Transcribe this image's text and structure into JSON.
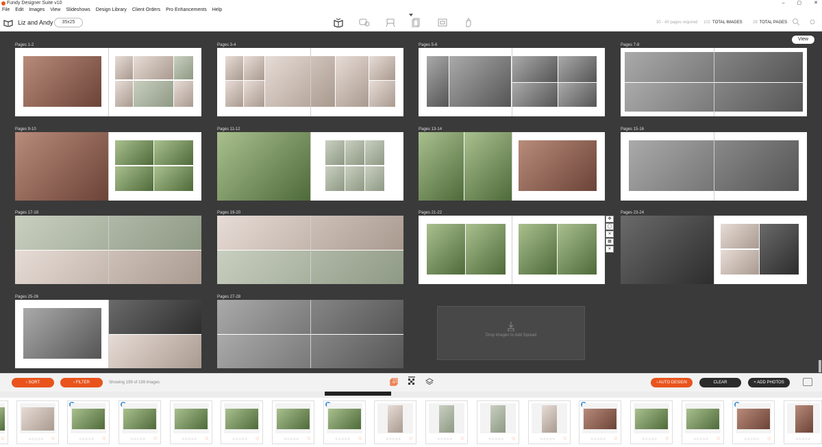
{
  "app": {
    "title": "Fundy Designer Suite v10",
    "window_controls": [
      "–",
      "▢",
      "✕"
    ]
  },
  "menu": [
    "File",
    "Edit",
    "Images",
    "View",
    "Slideshows",
    "Design Library",
    "Client Orders",
    "Pro Enhancements",
    "Help"
  ],
  "toolbar": {
    "project_name": "Liz and Andy",
    "album_size": "35x25",
    "pages_required": "30 - 40 pages required",
    "total_images_count": "102",
    "total_images_label": "TOTAL IMAGES",
    "total_pages_count": "28",
    "total_pages_label": "TOTAL PAGES",
    "view_icons": [
      "album-icon",
      "proof-icon",
      "wall-art-icon",
      "cards-icon",
      "slideshow-icon",
      "hand-icon"
    ]
  },
  "workspace": {
    "view_label": "View",
    "spreads": [
      "Pages 1-2",
      "Pages 3-4",
      "Pages 5-6",
      "Pages 7-8",
      "Pages 9-10",
      "Pages 11-12",
      "Pages 13-14",
      "Pages 15-16",
      "Pages 17-18",
      "Pages 19-20",
      "Pages 21-22",
      "Pages 23-24",
      "Pages 25-26",
      "Pages 27-28"
    ],
    "side_tools": [
      "✥",
      "◯",
      "✕",
      "▦",
      "✕"
    ],
    "dropzone_text": "Drop Images to Add Spread"
  },
  "actions": {
    "sort": "SORT",
    "filter": "FILTER",
    "showing": "Showing 199 of 199 images",
    "auto_design": "AUTO DESIGN",
    "clear": "CLEAR",
    "add_photos": "+ ADD PHOTOS"
  },
  "filmstrip": {
    "stars": "☆☆☆☆☆",
    "heart": "♡",
    "badge": "1"
  },
  "colors": {
    "accent": "#e8541c",
    "workspace": "#3a3a3a",
    "dark_button": "#2b2b2b"
  }
}
